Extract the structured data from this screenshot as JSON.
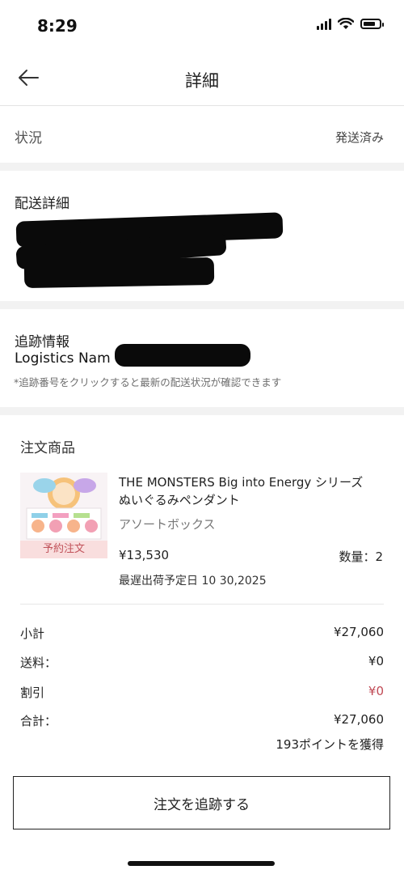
{
  "status_bar": {
    "time": "8:29",
    "battery_level": 0.8
  },
  "nav": {
    "title": "詳細",
    "back_icon": "arrow-left-icon"
  },
  "status_row": {
    "label": "状況",
    "value": "発送済み"
  },
  "delivery": {
    "title": "配送詳細"
  },
  "tracking": {
    "title": "追跡情報",
    "logistics_label": "Logistics Nam",
    "hint": "*追跡番号をクリックすると最新の配送状況が確認できます"
  },
  "order": {
    "title": "注文商品",
    "product": {
      "name_line1": "THE MONSTERS Big into Energy シリーズ",
      "name_line2": "ぬいぐるみペンダント",
      "variant": "アソートボックス",
      "price": "¥13,530",
      "quantity": "数量：2",
      "ship_date": "最遅出荷予定日 10 30,2025",
      "badge": "予約注文"
    }
  },
  "summary": {
    "subtotal_label": "小計",
    "subtotal_value": "¥27,060",
    "shipping_label": "送料：",
    "shipping_value": "¥0",
    "discount_label": "割引",
    "discount_value": "¥0",
    "total_label": "合計：",
    "total_value": "¥27,060",
    "points": "193ポイントを獲得"
  },
  "actions": {
    "track_button": "注文を追跡する"
  },
  "colors": {
    "accent_red": "#c04a55",
    "badge_bg": "#f9dede",
    "separator": "#f2f2f2"
  }
}
